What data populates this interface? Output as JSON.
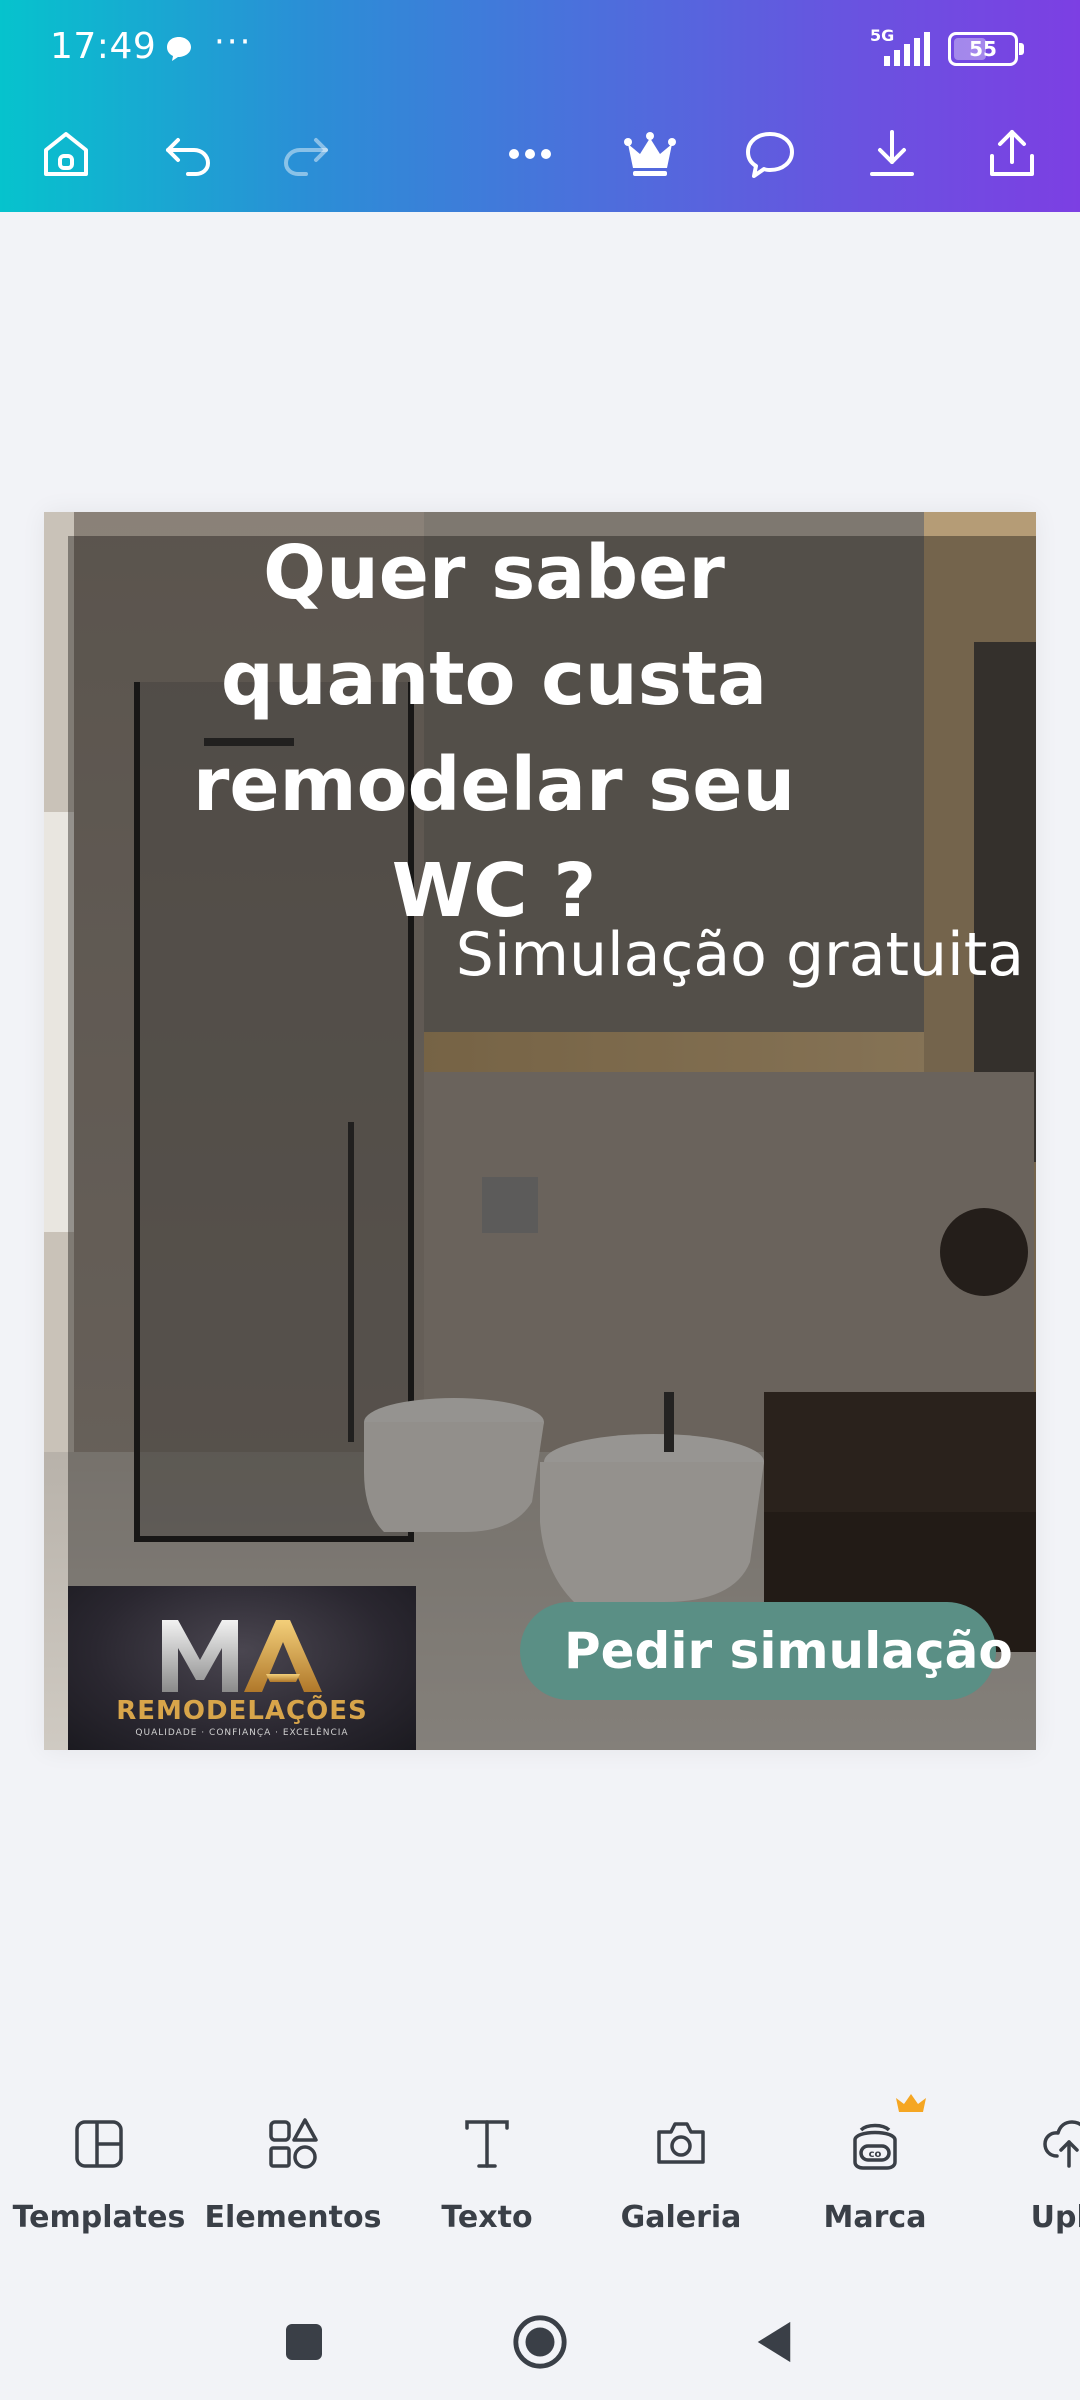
{
  "status": {
    "time": "17:49",
    "network": "5G",
    "battery": "55",
    "battery_level": 0.55
  },
  "toolbar": {
    "items": [
      {
        "icon": "home-icon"
      },
      {
        "icon": "undo-icon"
      },
      {
        "icon": "redo-icon"
      },
      {
        "icon": "more-icon"
      },
      {
        "icon": "crown-icon"
      },
      {
        "icon": "comment-icon"
      },
      {
        "icon": "download-icon"
      },
      {
        "icon": "share-icon"
      }
    ]
  },
  "design": {
    "headline": "Quer saber quanto custa remodelar seu WC ?",
    "subtitle": "Simulação gratuita",
    "cta": "Pedir simulação",
    "logo": {
      "letters": "MA",
      "name": "REMODELAÇÕES",
      "tagline": "QUALIDADE · CONFIANÇA · EXCELÊNCIA"
    }
  },
  "tools": [
    {
      "label": "Templates",
      "icon": "templates-icon"
    },
    {
      "label": "Elementos",
      "icon": "elements-icon"
    },
    {
      "label": "Texto",
      "icon": "text-icon"
    },
    {
      "label": "Galeria",
      "icon": "camera-icon"
    },
    {
      "label": "Marca",
      "icon": "brand-icon"
    },
    {
      "label": "Uplo",
      "icon": "upload-icon"
    }
  ],
  "colors": {
    "header_gradient_start": "#06c3cd",
    "header_gradient_end": "#7c3fe3",
    "cta": "#5a8f85",
    "logo_gold": "#d8a54a",
    "crown_badge": "#f5a623"
  }
}
